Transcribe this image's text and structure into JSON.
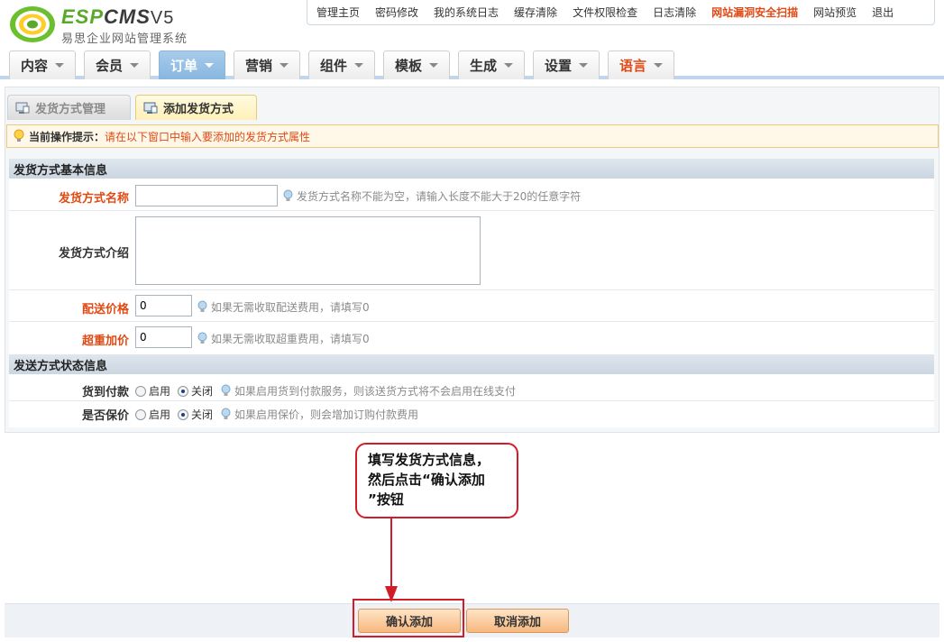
{
  "logo": {
    "brand_esp": "ESP",
    "brand_cms": "CMS",
    "version": "V5",
    "subtitle": "易思企业网站管理系统"
  },
  "toplinks": [
    {
      "label": "管理主页"
    },
    {
      "label": "密码修改"
    },
    {
      "label": "我的系统日志"
    },
    {
      "label": "缓存清除"
    },
    {
      "label": "文件权限检查"
    },
    {
      "label": "日志清除"
    },
    {
      "label": "网站漏洞安全扫描",
      "hot": true
    },
    {
      "label": "网站预览"
    },
    {
      "label": "退出"
    }
  ],
  "nav": [
    {
      "label": "内容"
    },
    {
      "label": "会员"
    },
    {
      "label": "订单",
      "active": true
    },
    {
      "label": "营销"
    },
    {
      "label": "组件"
    },
    {
      "label": "模板"
    },
    {
      "label": "生成"
    },
    {
      "label": "设置"
    },
    {
      "label": "语言",
      "lang": true
    }
  ],
  "subtabs": {
    "manage": "发货方式管理",
    "add": "添加发货方式"
  },
  "tip": {
    "label": "当前操作提示：",
    "text": "请在以下窗口中输入要添加的发货方式属性"
  },
  "section1": "发货方式基本信息",
  "section2": "发送方式状态信息",
  "fields": {
    "name": {
      "label": "发货方式名称",
      "value": "",
      "hint": "发货方式名称不能为空，请输入长度不能大于20的任意字符"
    },
    "intro": {
      "label": "发货方式介绍",
      "value": ""
    },
    "price": {
      "label": "配送价格",
      "value": "0",
      "hint": "如果无需收取配送费用，请填写0"
    },
    "overweight": {
      "label": "超重加价",
      "value": "0",
      "hint": "如果无需收取超重费用，请填写0"
    },
    "cod": {
      "label": "货到付款",
      "on_label": "启用",
      "off_label": "关闭",
      "selected": "关闭",
      "hint": "如果启用货到付款服务，则该送货方式将不会启用在线支付"
    },
    "insure": {
      "label": "是否保价",
      "on_label": "启用",
      "off_label": "关闭",
      "selected": "关闭",
      "hint": "如果启用保价，则会增加订购付款费用"
    }
  },
  "callout": {
    "line1": "填写发货方式信息，",
    "line2": "然后点击“确认添加",
    "line3": "”按钮"
  },
  "buttons": {
    "confirm": "确认添加",
    "cancel": "取消添加"
  },
  "colors": {
    "accent": "#e04a14",
    "nav_active": "#89b6df",
    "callout_red": "#d21c2a",
    "brand_green": "#5aa928"
  }
}
